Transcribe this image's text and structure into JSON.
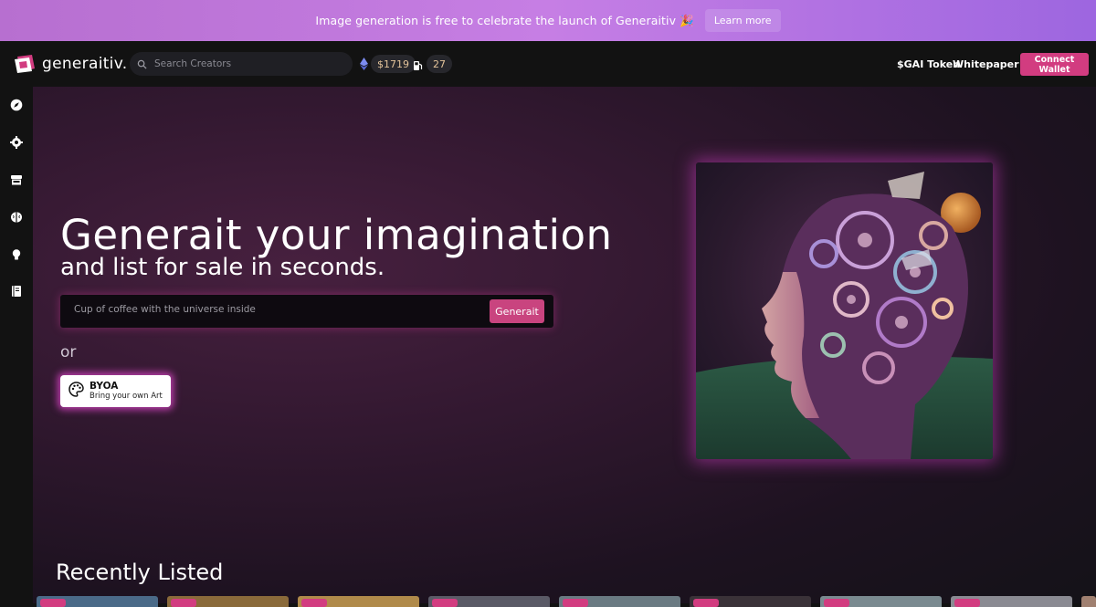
{
  "banner": {
    "text": "Image generation is free to celebrate the launch of Generaitiv 🎉",
    "button_label": "Learn more"
  },
  "header": {
    "logo_text": "generaitiv.",
    "search_placeholder": "Search Creators",
    "eth_price": "$1719",
    "gas_price": "27",
    "links": [
      "$GAI Token",
      "Whitepaper"
    ],
    "connect_label": "Connect Wallet"
  },
  "sidebar": {
    "icons": [
      "compass-icon",
      "settings-gear-icon",
      "store-icon",
      "brain-icon",
      "lightbulb-icon",
      "book-icon"
    ]
  },
  "hero": {
    "title": "Generait your imagination",
    "subtitle": "and list for sale in seconds.",
    "prompt_placeholder": "Cup of coffee with the universe inside",
    "generate_label": "Generait",
    "or_text": "or",
    "byoa_title": "BYOA",
    "byoa_subtitle": "Bring your own Art"
  },
  "recent": {
    "title": "Recently Listed",
    "thumb_count": 9
  },
  "colors": {
    "accent": "#d23c80",
    "banner_start": "#b76fd0",
    "banner_end": "#9d66e0",
    "eth_price": "#e3c39a"
  }
}
